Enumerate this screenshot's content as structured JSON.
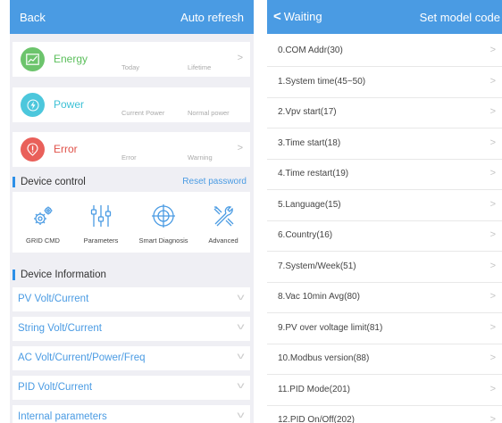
{
  "left": {
    "header": {
      "back": "Back",
      "auto_refresh": "Auto refresh"
    },
    "cards": [
      {
        "title": "Energy",
        "sub1": "Today",
        "sub2": "Lifetime",
        "color": "#5bbf5b",
        "circle": "#6cc46c",
        "icon": "chart-icon",
        "chevron": true
      },
      {
        "title": "Power",
        "sub1": "Current Power",
        "sub2": "Normal power",
        "color": "#3ec1d6",
        "circle": "#4cc7dc",
        "icon": "lightning-icon",
        "chevron": false
      },
      {
        "title": "Error",
        "sub1": "Error",
        "sub2": "Warning",
        "color": "#e0524a",
        "circle": "#e9605a",
        "icon": "error-icon",
        "chevron": true
      }
    ],
    "device_control": {
      "title": "Device control",
      "reset": "Reset password"
    },
    "tools": [
      {
        "label": "GRID CMD",
        "icon": "gears-icon"
      },
      {
        "label": "Parameters",
        "icon": "sliders-icon"
      },
      {
        "label": "Smart Diagnosis",
        "icon": "crosshair-icon"
      },
      {
        "label": "Advanced",
        "icon": "wrench-icon"
      }
    ],
    "device_info": {
      "title": "Device Information"
    },
    "accordion": [
      "PV Volt/Current",
      "String Volt/Current",
      "AC Volt/Current/Power/Freq",
      "PID Volt/Current",
      "Internal parameters"
    ],
    "chevron_right": ">",
    "chevron_down": "v"
  },
  "right": {
    "header": {
      "back_icon": "<",
      "waiting": "Waiting",
      "set_model": "Set model code"
    },
    "items": [
      "0.COM Addr(30)",
      "1.System time(45~50)",
      "2.Vpv start(17)",
      "3.Time start(18)",
      "4.Time restart(19)",
      "5.Language(15)",
      "6.Country(16)",
      "7.System/Week(51)",
      "8.Vac 10min Avg(80)",
      "9.PV over voltage limit(81)",
      "10.Modbus version(88)",
      "11.PID Mode(201)",
      "12.PID On/Off(202)"
    ],
    "chevron": ">"
  },
  "colors": {
    "accent": "#4a9be3",
    "background": "#efeff4"
  }
}
